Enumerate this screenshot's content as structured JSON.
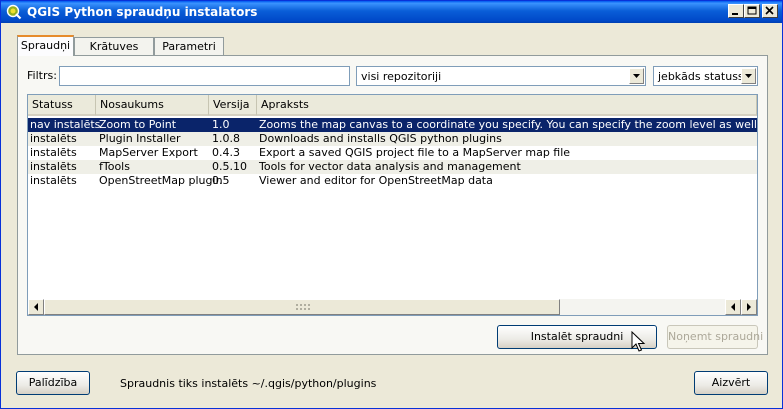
{
  "window": {
    "title": "QGIS Python spraudņu instalators",
    "controls": {
      "minimize_icon": "minimize-icon",
      "maximize_icon": "maximize-icon",
      "close_icon": "close-icon"
    }
  },
  "tabs": [
    {
      "label": "Spraudņi",
      "active": true
    },
    {
      "label": "Krātuves",
      "active": false
    },
    {
      "label": "Parametri",
      "active": false
    }
  ],
  "filter": {
    "label": "Filtrs:",
    "value": "",
    "repo_select": "visi repozitoriji",
    "status_select": "jebkāds statuss"
  },
  "table": {
    "columns": [
      "Statuss",
      "Nosaukums",
      "Versija",
      "Apraksts"
    ],
    "rows": [
      {
        "status": "nav instalēts",
        "name": "Zoom to Point",
        "version": "1.0",
        "description": "Zooms the map canvas to a coordinate you specify. You can specify the zoom level as well to control the",
        "selected": true
      },
      {
        "status": "instalēts",
        "name": "Plugin Installer",
        "version": "1.0.8",
        "description": "Downloads and installs QGIS python plugins",
        "selected": false
      },
      {
        "status": "instalēts",
        "name": "MapServer Export",
        "version": "0.4.3",
        "description": "Export a saved QGIS project file to a MapServer map file",
        "selected": false
      },
      {
        "status": "instalēts",
        "name": "fTools",
        "version": "0.5.10",
        "description": "Tools for vector data analysis and management",
        "selected": false
      },
      {
        "status": "instalēts",
        "name": "OpenStreetMap plugin",
        "version": "0.5",
        "description": "Viewer and editor for OpenStreetMap data",
        "selected": false
      }
    ]
  },
  "buttons": {
    "install": "Instalēt spraudni",
    "uninstall": "Noņemt spraudni",
    "help": "Palīdzība",
    "close": "Aizvērt"
  },
  "status_text": "Spraudnis tiks instalēts ~/.qgis/python/plugins",
  "colors": {
    "selection": "#0a246a",
    "alt_row": "#efefe7",
    "title_bar": "#0054e3"
  }
}
